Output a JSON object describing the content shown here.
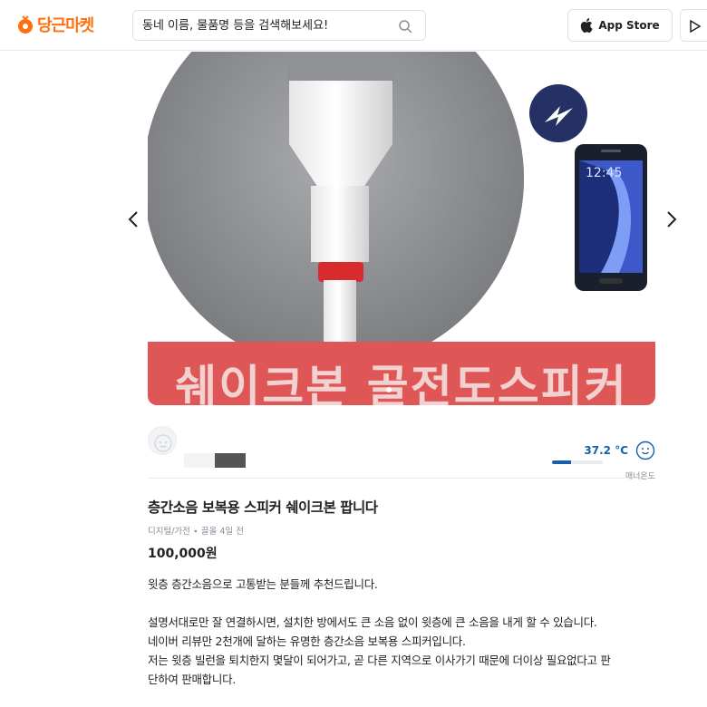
{
  "header": {
    "logo_text": "당근마켓",
    "search_placeholder": "동네 이름, 물품명 등을 검색해보세요!",
    "appstore_label": "App Store"
  },
  "colors": {
    "brand": "#ff6f0f",
    "temperature": "#1561a9",
    "banner": "#de5655"
  },
  "carousel": {
    "banner_text": "쉐이크본 골전도스피커",
    "icons": [
      "chevron-left-icon",
      "chevron-right-icon"
    ]
  },
  "profile": {
    "temperature": "37.2 °C",
    "temperature_level_percent": 37,
    "temperature_label": "매너온도"
  },
  "article": {
    "title": "층간소음 보복용 스피커 쉐이크본 팝니다",
    "meta": "디지털/가전 ∙ 끌올 4일 전",
    "price": "100,000원",
    "description": [
      "윗층 층간소음으로 고통받는 분들께 추천드립니다.",
      "",
      "설명서대로만 잘 연결하시면, 설치한 방에서도 큰 소음 없이 윗층에 큰 소음을 내게 할 수 있습니다.",
      "네이버 리뷰만 2천개에 달하는 유명한 층간소음 보복용 스피커입니다.",
      "저는 윗층 빌런을 퇴치한지 몇달이 되어가고, 곧 다른 지역으로 이사가기 때문에 더이상 필요없다고 판",
      "단하여 판매합니다."
    ]
  }
}
